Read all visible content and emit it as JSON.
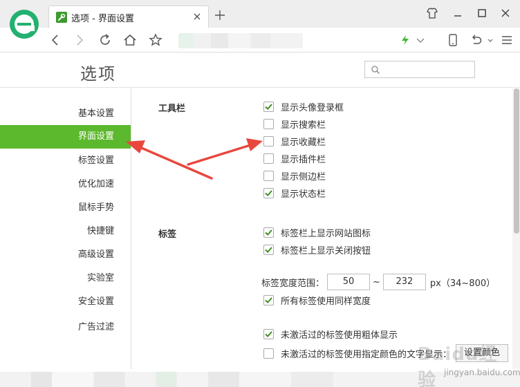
{
  "browser": {
    "tab_title": "选项 - 界面设置",
    "new_tab_symbol": "+"
  },
  "header": {
    "title": "选项",
    "search_placeholder": ""
  },
  "sidebar": {
    "items": [
      {
        "label": "基本设置"
      },
      {
        "label": "界面设置"
      },
      {
        "label": "标签设置"
      },
      {
        "label": "优化加速"
      },
      {
        "label": "鼠标手势"
      },
      {
        "label": "快捷键"
      },
      {
        "label": "高级设置"
      },
      {
        "label": "实验室"
      },
      {
        "label": "安全设置"
      },
      {
        "label": "广告过滤"
      }
    ],
    "active_index": 1
  },
  "toolbar_section": {
    "title": "工具栏",
    "options": [
      {
        "label": "显示头像登录框",
        "checked": true
      },
      {
        "label": "显示搜索栏",
        "checked": false
      },
      {
        "label": "显示收藏栏",
        "checked": false
      },
      {
        "label": "显示插件栏",
        "checked": false
      },
      {
        "label": "显示侧边栏",
        "checked": false
      },
      {
        "label": "显示状态栏",
        "checked": true
      }
    ]
  },
  "tabs_section": {
    "title": "标签",
    "options": [
      {
        "label": "标签栏上显示网站图标",
        "checked": true
      },
      {
        "label": "标签栏上显示关闭按钮",
        "checked": true
      }
    ],
    "width_range": {
      "label": "标签宽度范围：",
      "min_value": "50",
      "separator": "~",
      "max_value": "232",
      "unit_hint": "px（34~800）"
    },
    "more_options": [
      {
        "label": "所有标签使用同样宽度",
        "checked": true
      },
      {
        "label": "未激活过的标签使用粗体显示",
        "checked": true
      },
      {
        "label": "未激活过的标签使用指定颜色的文字显示：",
        "checked": false
      }
    ],
    "color_button_label": "设置颜色"
  },
  "watermark": {
    "brand": "Baidu经验",
    "url": "jingyan.baidu.com"
  },
  "colors": {
    "accent": "#5cb82d",
    "checkmark": "#3b8d1f",
    "arrow": "#e8473d"
  }
}
